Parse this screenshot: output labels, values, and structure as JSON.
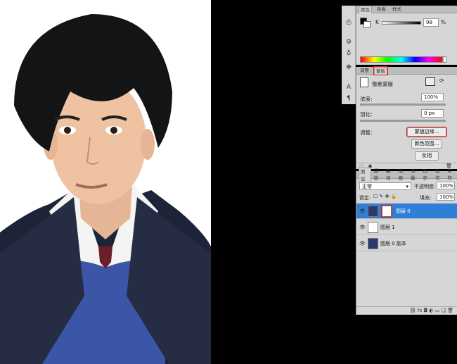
{
  "color_panel": {
    "tabs": [
      "颜色",
      "色板",
      "样式"
    ],
    "active_tab": 0,
    "channel_label": "K",
    "channel_value": "98",
    "channel_unit": "%"
  },
  "adjust_panel": {
    "tabs": [
      "调整",
      "蒙版"
    ],
    "active_tab": 1,
    "mask_type": "像素蒙版",
    "density_label": "浓度:",
    "density_value": "100%",
    "feather_label": "羽化:",
    "feather_value": "0 px",
    "refine_label": "调整:",
    "mask_edge_button": "蒙版边缘...",
    "color_range_button": "颜色范围...",
    "invert_button": "反相"
  },
  "layers_panel": {
    "tabs": [
      "图层",
      "通道",
      "路径",
      "动画",
      "测量",
      "历史",
      "动作",
      "字符"
    ],
    "blend_mode": "正常",
    "opacity_label": "不透明度:",
    "opacity_value": "100%",
    "lock_label": "锁定:",
    "fill_label": "填充:",
    "fill_value": "100%",
    "layers": [
      {
        "name": "图层 0",
        "selected": true
      },
      {
        "name": "图层 1",
        "selected": false
      },
      {
        "name": "图层 0 副本",
        "selected": false
      }
    ],
    "footer_icons": [
      "link-icon",
      "fx-icon",
      "mask-icon",
      "adjustment-icon",
      "group-icon",
      "new-layer-icon",
      "trash-icon"
    ]
  },
  "tool_icons": [
    "history-icon",
    "settings-icon",
    "clone-source-icon",
    "puppet-icon",
    "text-icon",
    "paragraph-icon"
  ],
  "colors": {
    "panel": "#d6d6d6",
    "selection": "#2f7fd6",
    "highlight": "#e11111"
  }
}
